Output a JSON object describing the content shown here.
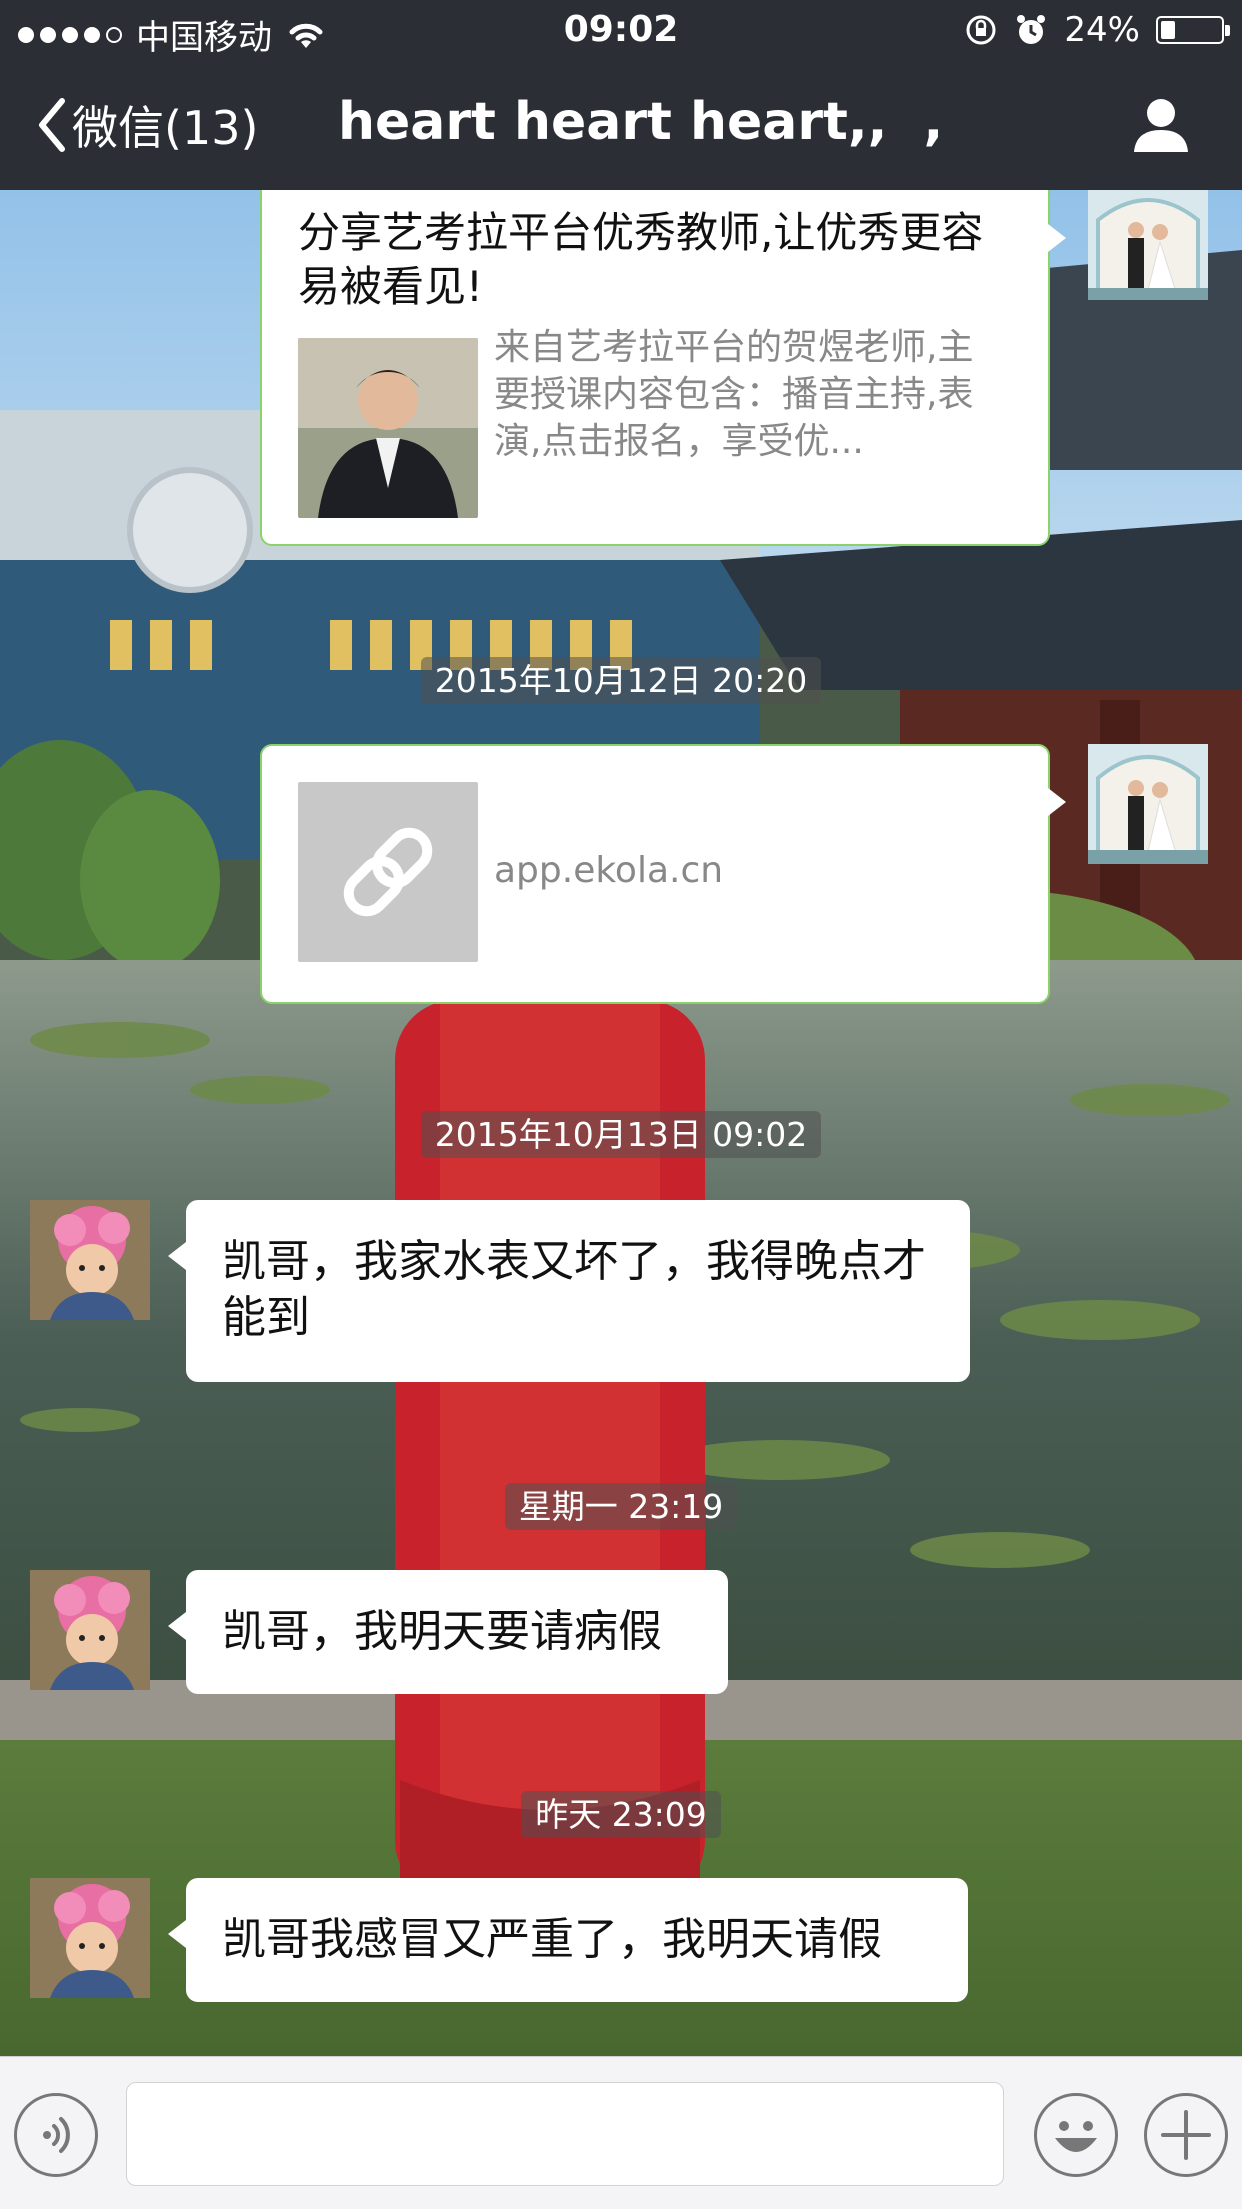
{
  "status_bar": {
    "carrier": "中国移动",
    "time": "09:02",
    "battery": "24%",
    "battery_fraction": 0.24,
    "signal_bars_filled": 4,
    "signal_bars_total": 5
  },
  "nav": {
    "back_label": "微信(13)",
    "title": "heart heart heart,,  ,"
  },
  "messages": [
    {
      "sender": "me",
      "type": "link-card",
      "title": "分享艺考拉平台优秀教师,让优秀更容易被看见!",
      "description": "来自艺考拉平台的贺煜老师,主要授课内容包含：播音主持,表演,点击报名，享受优..."
    },
    {
      "type": "timestamp",
      "text": "2015年10月12日 20:20"
    },
    {
      "sender": "me",
      "type": "link-card",
      "host": "app.ekola.cn"
    },
    {
      "type": "timestamp",
      "text": "2015年10月13日 09:02"
    },
    {
      "sender": "other",
      "type": "text",
      "text": "凯哥，我家水表又坏了，我得晚点才能到"
    },
    {
      "type": "timestamp",
      "text": "星期一 23:19"
    },
    {
      "sender": "other",
      "type": "text",
      "text": "凯哥，我明天要请病假"
    },
    {
      "type": "timestamp",
      "text": "昨天 23:09"
    },
    {
      "sender": "other",
      "type": "text",
      "text": "凯哥我感冒又严重了，我明天请假"
    }
  ],
  "input_bar": {
    "text_value": ""
  },
  "colors": {
    "topbar": "#2b2f35",
    "my_bubble_border": "#8cd26a",
    "bubble_bg": "#ffffff"
  },
  "icons": [
    "wifi-icon",
    "rotation-lock-icon",
    "alarm-icon",
    "battery-icon",
    "back-chevron-icon",
    "profile-icon",
    "link-icon",
    "voice-icon",
    "emoji-icon",
    "plus-icon"
  ]
}
